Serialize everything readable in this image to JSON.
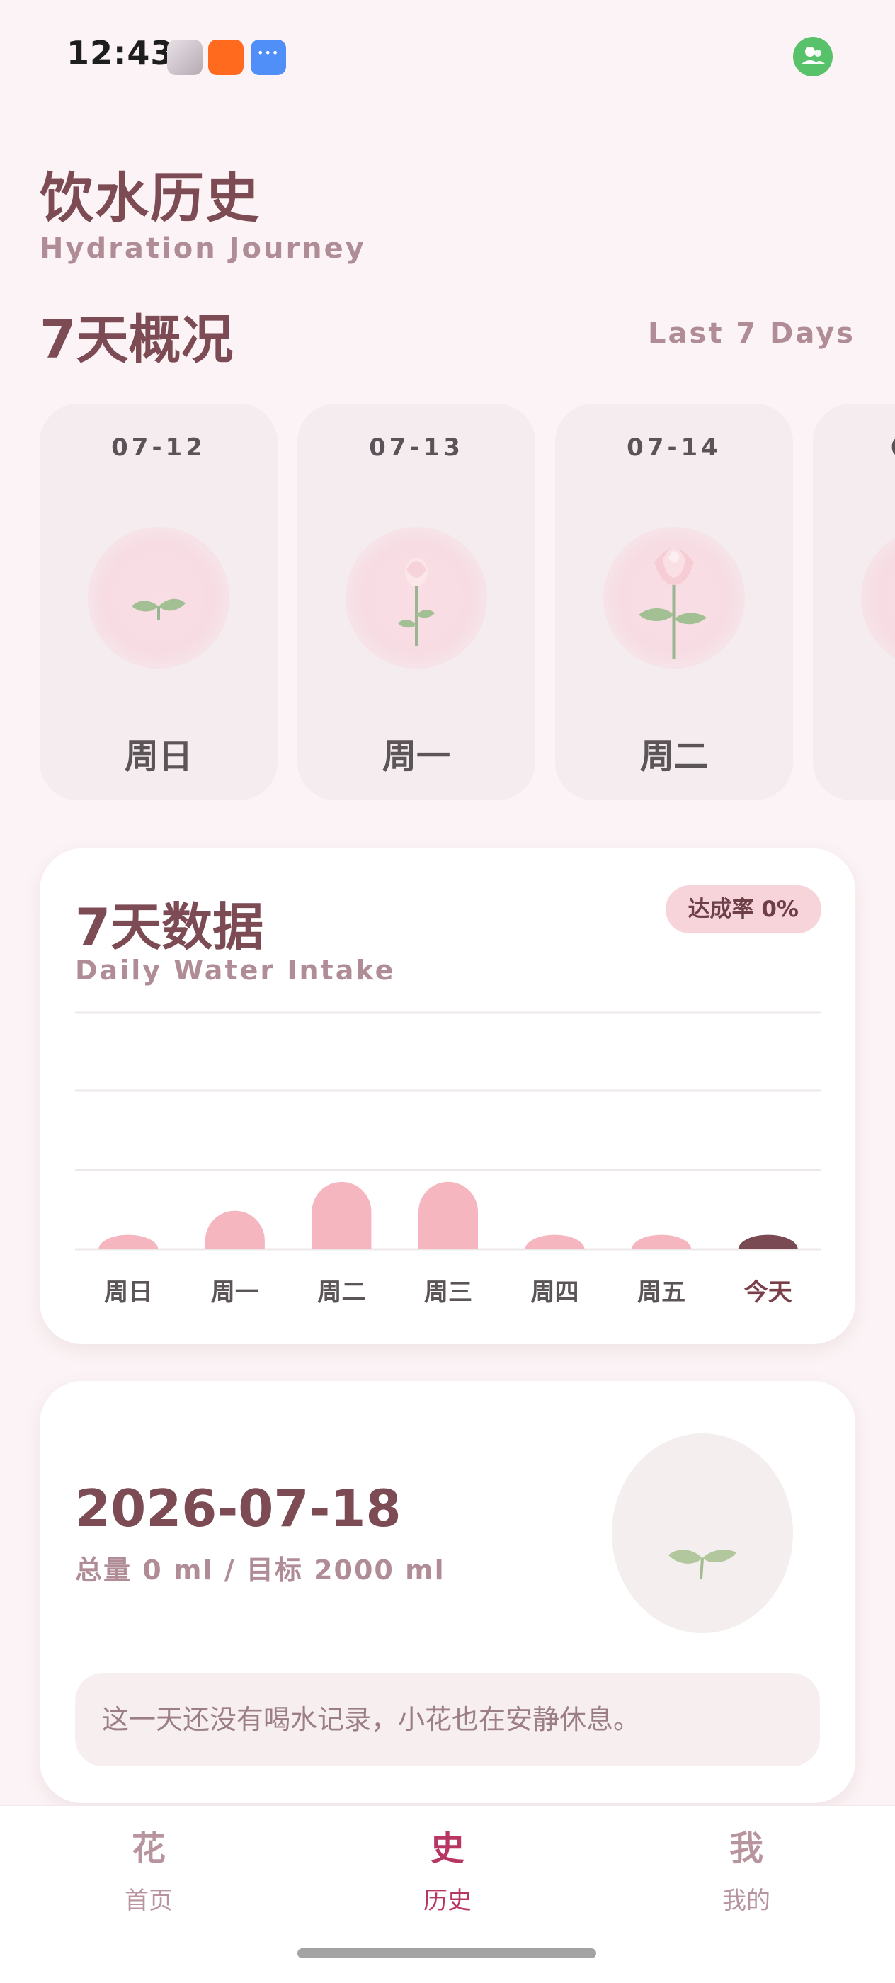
{
  "status_bar": {
    "time": "12:43",
    "apps": [
      "avatar-app",
      "taobao-app",
      "message-app"
    ],
    "taobao_label": "淘宝\n闪购"
  },
  "header": {
    "title": "饮水历史",
    "subtitle": "Hydration Journey"
  },
  "overview": {
    "title": "7天概况",
    "subtitle": "Last 7 Days",
    "days": [
      {
        "date": "07-12",
        "weekday": "周日",
        "stage": "sprout"
      },
      {
        "date": "07-13",
        "weekday": "周一",
        "stage": "bud"
      },
      {
        "date": "07-14",
        "weekday": "周二",
        "stage": "bloom"
      },
      {
        "date": "0",
        "weekday": "",
        "stage": "partial"
      }
    ]
  },
  "chart": {
    "title": "7天数据",
    "subtitle": "Daily Water Intake",
    "rate_badge": "达成率 0%"
  },
  "chart_data": {
    "type": "bar",
    "categories": [
      "周日",
      "周一",
      "周二",
      "周三",
      "周四",
      "周五",
      "今天"
    ],
    "values": [
      0.06,
      0.16,
      0.28,
      0.28,
      0.06,
      0.06,
      0.06
    ],
    "ylim": [
      0,
      1
    ],
    "grid": true,
    "colors": {
      "bar": "#f5b6c0",
      "today": "#7a4a52"
    }
  },
  "detail": {
    "date": "2026-07-18",
    "total": "总量 0 ml / 目标 2000 ml",
    "message": "这一天还没有喝水记录，小花也在安静休息。"
  },
  "bottom_nav": {
    "items": [
      {
        "icon": "花",
        "label": "首页"
      },
      {
        "icon": "史",
        "label": "历史"
      },
      {
        "icon": "我",
        "label": "我的"
      }
    ],
    "active_index": 1
  },
  "colors": {
    "background": "#fbf3f5",
    "primary": "#7c4b53",
    "muted": "#b08d96",
    "accent": "#b83663"
  }
}
